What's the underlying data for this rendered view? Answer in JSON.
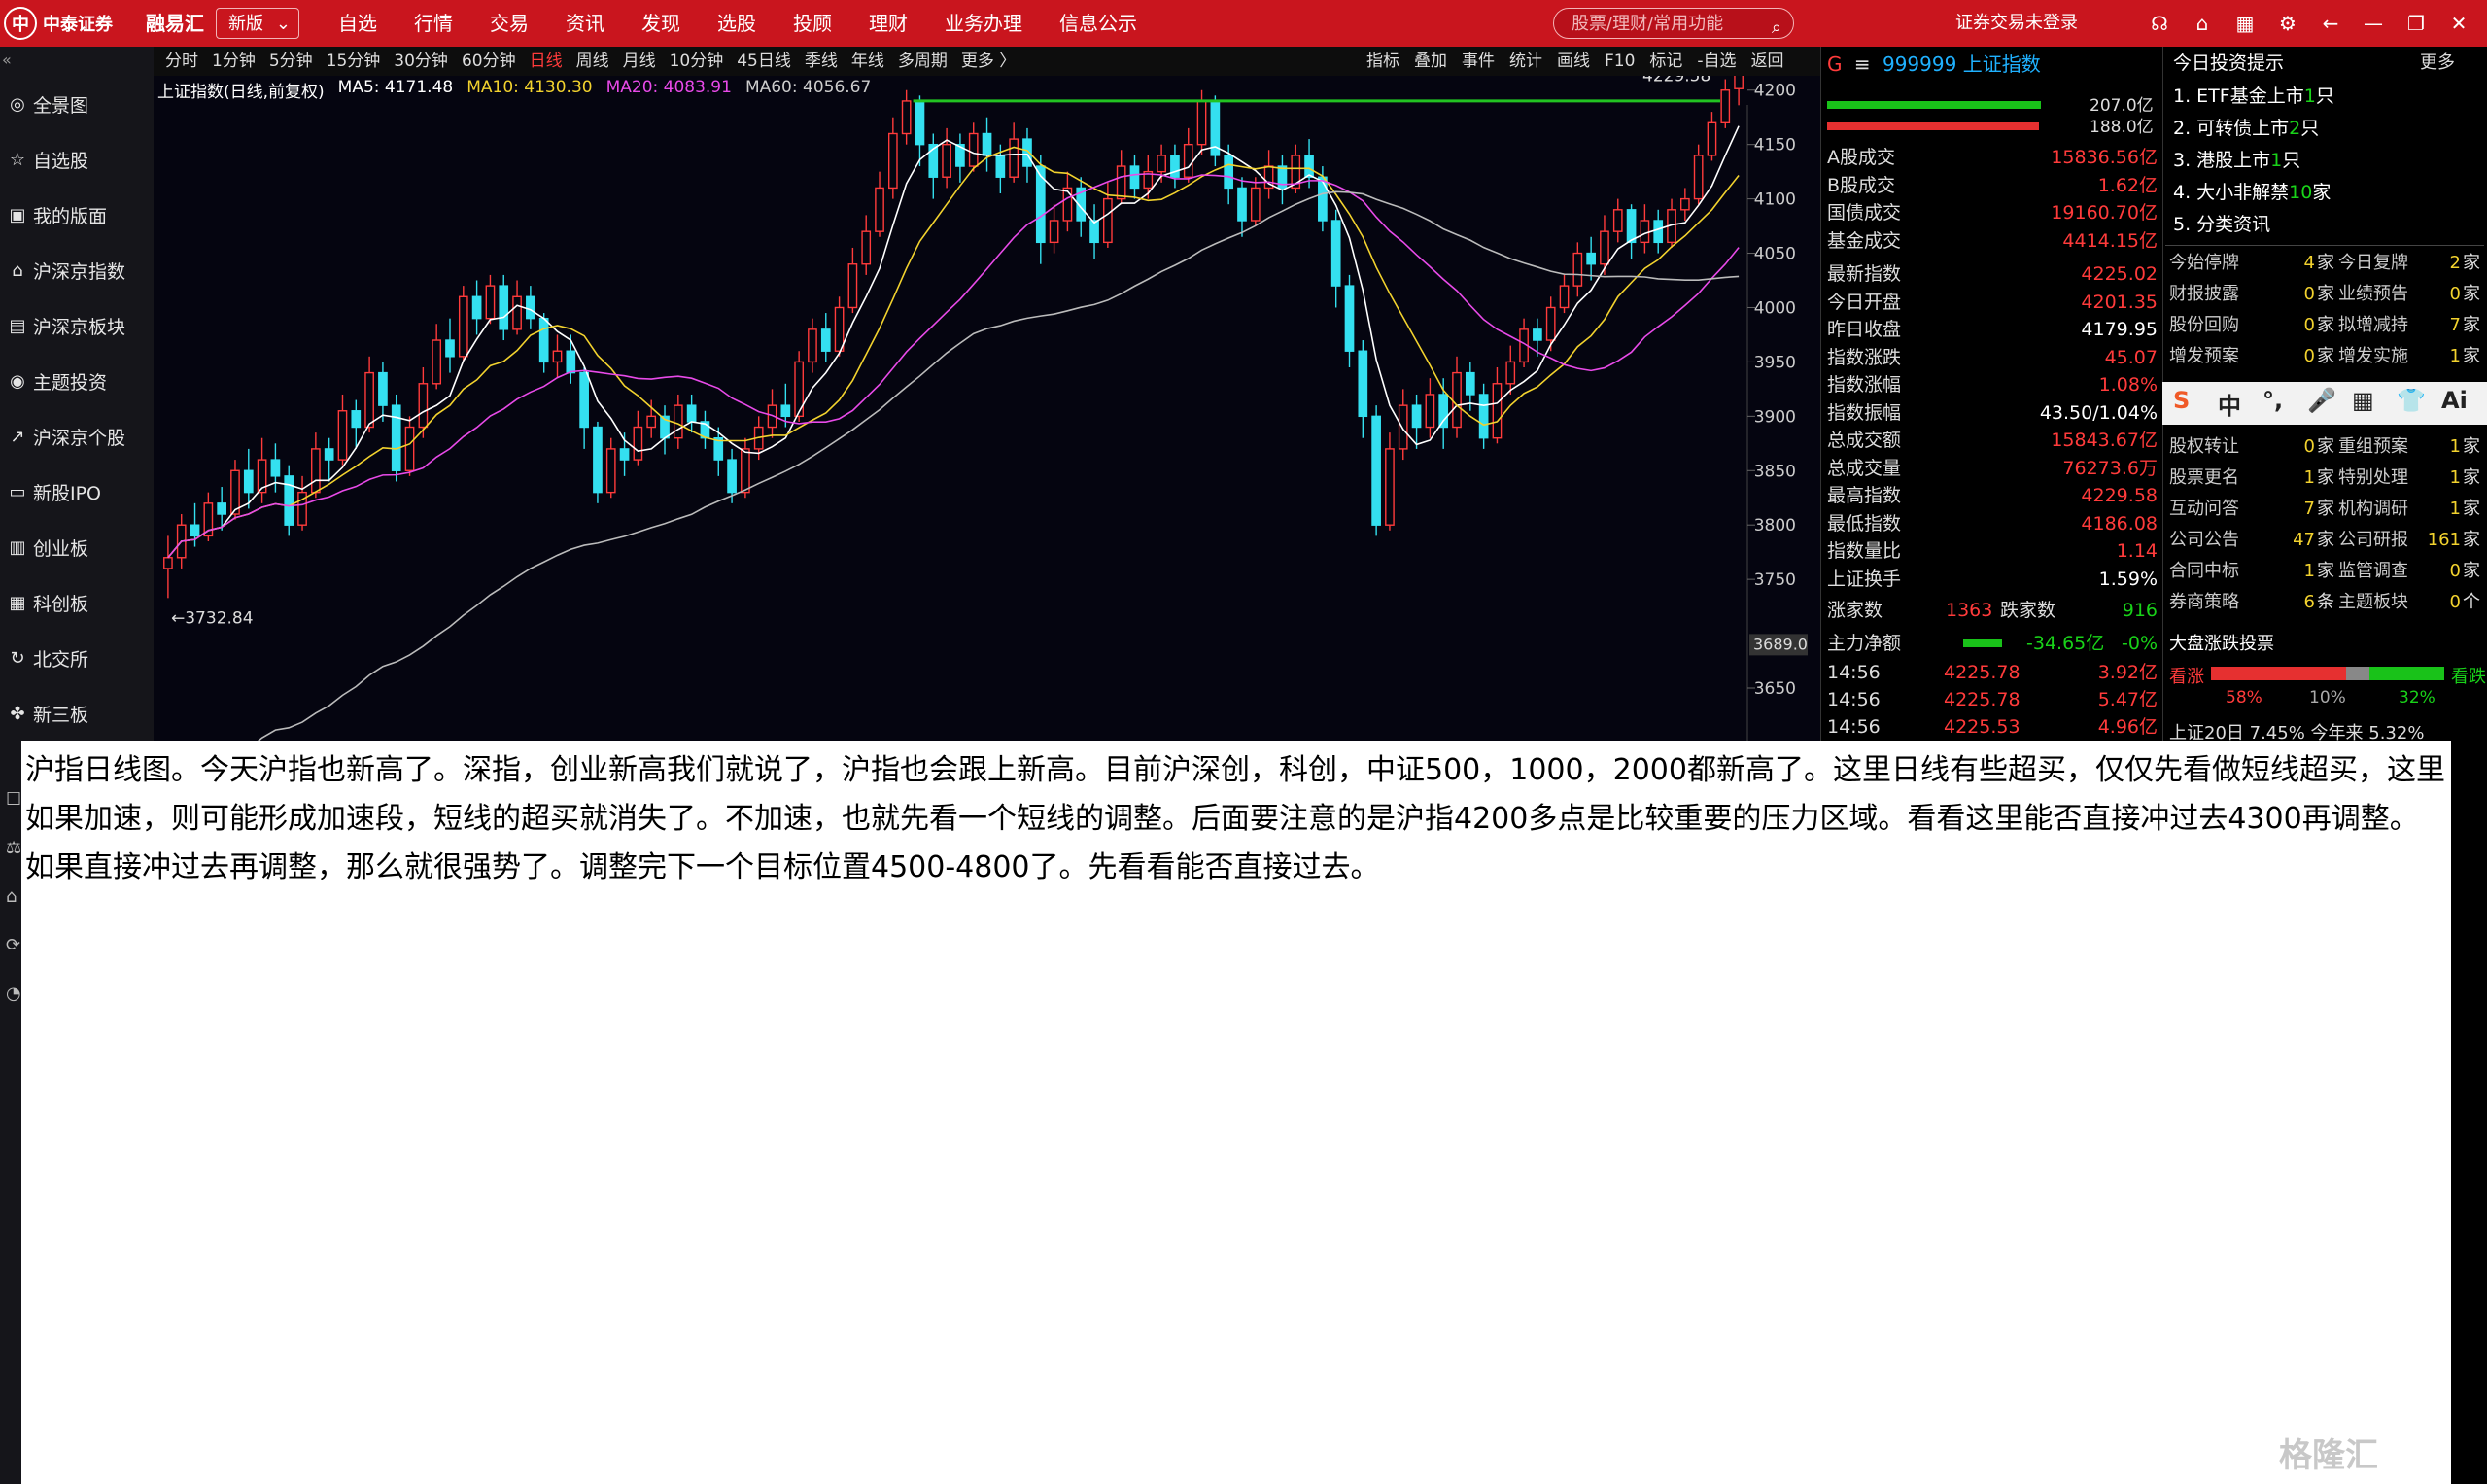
{
  "topbar": {
    "logo_text": "中泰证券",
    "brand2": "融易汇",
    "version_select": "新版",
    "nav": [
      "自选",
      "行情",
      "交易",
      "资讯",
      "发现",
      "选股",
      "投顾",
      "理财",
      "业务办理",
      "信息公示"
    ],
    "search_placeholder": "股票/理财/常用功能",
    "login_status": "证券交易未登录",
    "colors": {
      "bar": "#c9151e"
    }
  },
  "sidebar": {
    "items": [
      {
        "icon": "globe-icon",
        "label": "全景图"
      },
      {
        "icon": "star-icon",
        "label": "自选股"
      },
      {
        "icon": "layout-icon",
        "label": "我的版面"
      },
      {
        "icon": "index-icon",
        "label": "沪深京指数"
      },
      {
        "icon": "sector-icon",
        "label": "沪深京板块"
      },
      {
        "icon": "theme-icon",
        "label": "主题投资"
      },
      {
        "icon": "stock-icon",
        "label": "沪深京个股"
      },
      {
        "icon": "ipo-icon",
        "label": "新股IPO"
      },
      {
        "icon": "gem-icon",
        "label": "创业板"
      },
      {
        "icon": "star-market-icon",
        "label": "科创板"
      },
      {
        "icon": "bse-icon",
        "label": "北交所"
      },
      {
        "icon": "neeq-icon",
        "label": "新三板"
      }
    ]
  },
  "chart_toolbar": {
    "periods": [
      "分时",
      "1分钟",
      "5分钟",
      "15分钟",
      "30分钟",
      "60分钟",
      "日线",
      "周线",
      "月线",
      "10分钟",
      "45日线",
      "季线",
      "年线",
      "多周期",
      "更多 〉"
    ],
    "active_period": "日线",
    "tools": [
      "指标",
      "叠加",
      "事件",
      "统计",
      "画线",
      "F10",
      "标记",
      "-自选",
      "返回"
    ]
  },
  "ma_legend": {
    "title": "上证指数(日线,前复权)",
    "ma5": "MA5: 4171.48",
    "ma10": "MA10: 4130.30",
    "ma20": "MA20: 4083.91",
    "ma60": "MA60: 4056.67"
  },
  "chart_data": {
    "type": "candlestick",
    "y_ticks": [
      "4200",
      "4150",
      "4100",
      "4050",
      "4000",
      "3950",
      "3900",
      "3850",
      "3800",
      "3750",
      "3650"
    ],
    "ylim": [
      3650,
      4240
    ],
    "current_price_tag": "3689.0",
    "annotations": {
      "high_label": "4229.58",
      "low_label": "3732.84",
      "resistance_level": 4190
    },
    "candles": [
      [
        3760,
        3770,
        3732.84,
        3790
      ],
      [
        3770,
        3800,
        3760,
        3810
      ],
      [
        3800,
        3790,
        3780,
        3820
      ],
      [
        3790,
        3820,
        3785,
        3830
      ],
      [
        3820,
        3810,
        3795,
        3835
      ],
      [
        3810,
        3850,
        3805,
        3860
      ],
      [
        3850,
        3830,
        3815,
        3870
      ],
      [
        3830,
        3860,
        3820,
        3880
      ],
      [
        3860,
        3845,
        3830,
        3875
      ],
      [
        3845,
        3800,
        3790,
        3855
      ],
      [
        3800,
        3830,
        3795,
        3845
      ],
      [
        3830,
        3870,
        3825,
        3885
      ],
      [
        3870,
        3860,
        3840,
        3880
      ],
      [
        3860,
        3905,
        3855,
        3920
      ],
      [
        3905,
        3890,
        3870,
        3915
      ],
      [
        3890,
        3940,
        3885,
        3955
      ],
      [
        3940,
        3910,
        3895,
        3950
      ],
      [
        3910,
        3850,
        3840,
        3920
      ],
      [
        3850,
        3890,
        3845,
        3900
      ],
      [
        3890,
        3930,
        3880,
        3945
      ],
      [
        3930,
        3970,
        3925,
        3985
      ],
      [
        3970,
        3955,
        3940,
        3990
      ],
      [
        3955,
        4010,
        3950,
        4020
      ],
      [
        4010,
        3990,
        3975,
        4025
      ],
      [
        3990,
        4020,
        3985,
        4030
      ],
      [
        4020,
        3980,
        3970,
        4030
      ],
      [
        3980,
        4010,
        3975,
        4025
      ],
      [
        4010,
        3990,
        3980,
        4020
      ],
      [
        3990,
        3950,
        3940,
        3995
      ],
      [
        3950,
        3960,
        3935,
        3975
      ],
      [
        3960,
        3940,
        3930,
        3975
      ],
      [
        3940,
        3890,
        3870,
        3945
      ],
      [
        3890,
        3830,
        3820,
        3895
      ],
      [
        3830,
        3870,
        3825,
        3880
      ],
      [
        3870,
        3860,
        3845,
        3885
      ],
      [
        3860,
        3890,
        3855,
        3905
      ],
      [
        3890,
        3900,
        3880,
        3915
      ],
      [
        3900,
        3880,
        3865,
        3910
      ],
      [
        3880,
        3910,
        3870,
        3920
      ],
      [
        3910,
        3895,
        3885,
        3920
      ],
      [
        3895,
        3880,
        3870,
        3905
      ],
      [
        3880,
        3860,
        3845,
        3890
      ],
      [
        3860,
        3830,
        3820,
        3870
      ],
      [
        3830,
        3870,
        3825,
        3880
      ],
      [
        3870,
        3890,
        3860,
        3900
      ],
      [
        3890,
        3910,
        3880,
        3925
      ],
      [
        3910,
        3900,
        3890,
        3930
      ],
      [
        3900,
        3950,
        3895,
        3960
      ],
      [
        3950,
        3980,
        3940,
        3990
      ],
      [
        3980,
        3960,
        3950,
        3995
      ],
      [
        3960,
        4000,
        3955,
        4010
      ],
      [
        4000,
        4040,
        3995,
        4055
      ],
      [
        4040,
        4070,
        4030,
        4085
      ],
      [
        4070,
        4110,
        4065,
        4125
      ],
      [
        4110,
        4160,
        4100,
        4175
      ],
      [
        4160,
        4190,
        4150,
        4200
      ],
      [
        4190,
        4150,
        4130,
        4195
      ],
      [
        4150,
        4120,
        4100,
        4160
      ],
      [
        4120,
        4150,
        4110,
        4165
      ],
      [
        4150,
        4130,
        4115,
        4160
      ],
      [
        4130,
        4160,
        4125,
        4170
      ],
      [
        4160,
        4140,
        4125,
        4175
      ],
      [
        4140,
        4120,
        4105,
        4150
      ],
      [
        4120,
        4155,
        4115,
        4170
      ],
      [
        4155,
        4130,
        4115,
        4165
      ],
      [
        4130,
        4060,
        4040,
        4140
      ],
      [
        4060,
        4080,
        4050,
        4095
      ],
      [
        4080,
        4110,
        4070,
        4125
      ],
      [
        4110,
        4080,
        4065,
        4120
      ],
      [
        4080,
        4060,
        4045,
        4095
      ],
      [
        4060,
        4100,
        4055,
        4115
      ],
      [
        4100,
        4130,
        4095,
        4145
      ],
      [
        4130,
        4110,
        4100,
        4140
      ],
      [
        4110,
        4125,
        4100,
        4140
      ],
      [
        4125,
        4140,
        4115,
        4150
      ],
      [
        4140,
        4120,
        4110,
        4150
      ],
      [
        4120,
        4150,
        4115,
        4165
      ],
      [
        4150,
        4190,
        4140,
        4200
      ],
      [
        4190,
        4140,
        4130,
        4195
      ],
      [
        4140,
        4110,
        4095,
        4150
      ],
      [
        4110,
        4080,
        4065,
        4120
      ],
      [
        4080,
        4110,
        4075,
        4120
      ],
      [
        4110,
        4130,
        4100,
        4145
      ],
      [
        4130,
        4110,
        4095,
        4140
      ],
      [
        4110,
        4140,
        4105,
        4150
      ],
      [
        4140,
        4120,
        4110,
        4155
      ],
      [
        4120,
        4080,
        4070,
        4130
      ],
      [
        4080,
        4020,
        4000,
        4090
      ],
      [
        4020,
        3960,
        3945,
        4030
      ],
      [
        3960,
        3900,
        3880,
        3970
      ],
      [
        3900,
        3800,
        3790,
        3910
      ],
      [
        3800,
        3870,
        3795,
        3885
      ],
      [
        3870,
        3910,
        3860,
        3925
      ],
      [
        3910,
        3890,
        3870,
        3920
      ],
      [
        3890,
        3920,
        3880,
        3935
      ],
      [
        3920,
        3890,
        3870,
        3935
      ],
      [
        3890,
        3940,
        3880,
        3955
      ],
      [
        3940,
        3920,
        3905,
        3950
      ],
      [
        3920,
        3880,
        3870,
        3930
      ],
      [
        3880,
        3930,
        3875,
        3945
      ],
      [
        3930,
        3950,
        3920,
        3965
      ],
      [
        3950,
        3980,
        3945,
        3990
      ],
      [
        3980,
        3970,
        3955,
        3990
      ],
      [
        3970,
        4000,
        3960,
        4010
      ],
      [
        4000,
        4020,
        3995,
        4030
      ],
      [
        4020,
        4050,
        4010,
        4060
      ],
      [
        4050,
        4040,
        4025,
        4065
      ],
      [
        4040,
        4070,
        4030,
        4085
      ],
      [
        4070,
        4090,
        4060,
        4100
      ],
      [
        4090,
        4060,
        4045,
        4095
      ],
      [
        4060,
        4080,
        4050,
        4095
      ],
      [
        4080,
        4060,
        4050,
        4090
      ],
      [
        4060,
        4090,
        4055,
        4100
      ],
      [
        4090,
        4100,
        4080,
        4110
      ],
      [
        4100,
        4140,
        4095,
        4150
      ],
      [
        4140,
        4170,
        4135,
        4180
      ],
      [
        4170,
        4200,
        4165,
        4210
      ],
      [
        4201.35,
        4225.02,
        4186.08,
        4229.58
      ]
    ]
  },
  "quote": {
    "code": "999999",
    "name": "上证指数",
    "volbars": [
      "207.0亿",
      "188.0亿"
    ],
    "rows": [
      {
        "k": "A股成交",
        "v": "15836.56亿",
        "c": "red"
      },
      {
        "k": "B股成交",
        "v": "1.62亿",
        "c": "red"
      },
      {
        "k": "国债成交",
        "v": "19160.70亿",
        "c": "red"
      },
      {
        "k": "基金成交",
        "v": "4414.15亿",
        "c": "red"
      },
      {
        "k": "最新指数",
        "v": "4225.02",
        "c": "red"
      },
      {
        "k": "今日开盘",
        "v": "4201.35",
        "c": "red"
      },
      {
        "k": "昨日收盘",
        "v": "4179.95",
        "c": "white"
      },
      {
        "k": "指数涨跌",
        "v": "45.07",
        "c": "red"
      },
      {
        "k": "指数涨幅",
        "v": "1.08%",
        "c": "red"
      },
      {
        "k": "指数振幅",
        "v": "43.50/1.04%",
        "c": "white"
      },
      {
        "k": "总成交额",
        "v": "15843.67亿",
        "c": "red"
      },
      {
        "k": "总成交量",
        "v": "76273.6万",
        "c": "red"
      },
      {
        "k": "最高指数",
        "v": "4229.58",
        "c": "red"
      },
      {
        "k": "最低指数",
        "v": "4186.08",
        "c": "red"
      },
      {
        "k": "指数量比",
        "v": "1.14",
        "c": "red"
      },
      {
        "k": "上证换手",
        "v": "1.59%",
        "c": "white"
      }
    ],
    "up_label": "涨家数",
    "up_count": "1363",
    "down_label": "跌家数",
    "down_count": "916",
    "netflow_label": "主力净额",
    "netflow_value": "-34.65亿",
    "netflow_pct": "-0%",
    "ticks": [
      {
        "t": "14:56",
        "p": "4225.78",
        "a": "3.92亿"
      },
      {
        "t": "14:56",
        "p": "4225.78",
        "a": "5.47亿"
      },
      {
        "t": "14:56",
        "p": "4225.53",
        "a": "4.96亿"
      }
    ]
  },
  "tips": {
    "title": "今日投资提示",
    "more": "更多",
    "list": [
      {
        "pre": "1. ETF基金上市",
        "num": "1",
        "suf": "只"
      },
      {
        "pre": "2. 可转债上市",
        "num": "2",
        "suf": "只"
      },
      {
        "pre": "3. 港股上市",
        "num": "1",
        "suf": "只"
      },
      {
        "pre": "4. 大小非解禁",
        "num": "10",
        "suf": "家"
      },
      {
        "pre": "5. 分类资讯",
        "num": "",
        "suf": ""
      }
    ],
    "events": [
      [
        "今始停牌",
        "4",
        "家",
        "今日复牌",
        "2",
        "家"
      ],
      [
        "财报披露",
        "0",
        "家",
        "业绩预告",
        "0",
        "家"
      ],
      [
        "股份回购",
        "0",
        "家",
        "拟增减持",
        "7",
        "家"
      ],
      [
        "增发预案",
        "0",
        "家",
        "增发实施",
        "1",
        "家"
      ],
      [
        "股权转让",
        "0",
        "家",
        "重组预案",
        "1",
        "家"
      ],
      [
        "股票更名",
        "1",
        "家",
        "特别处理",
        "1",
        "家"
      ],
      [
        "互动问答",
        "7",
        "家",
        "机构调研",
        "1",
        "家"
      ],
      [
        "公司公告",
        "47",
        "家",
        "公司研报",
        "161",
        "家"
      ],
      [
        "合同中标",
        "1",
        "家",
        "监管调查",
        "0",
        "家"
      ],
      [
        "券商策略",
        "6",
        "条",
        "主题板块",
        "0",
        "个"
      ]
    ],
    "ime": [
      "S",
      "中",
      "°,",
      "🎤",
      "▦",
      "👕",
      "Ai"
    ],
    "vote_title": "大盘涨跌投票",
    "vote_up": "看涨",
    "vote_down": "看跌",
    "vote_up_pct": "58%",
    "vote_flat_pct": "10%",
    "vote_down_pct": "32%",
    "bottom_cut": "上证20日 7.45% 今年来 5.32%"
  },
  "commentary": "沪指日线图。今天沪指也新高了。深指，创业新高我们就说了，沪指也会跟上新高。目前沪深创，科创，中证500，1000，2000都新高了。这里日线有些超买，仅仅先看做短线超买，这里如果加速，则可能形成加速段，短线的超买就消失了。不加速，也就先看一个短线的调整。后面要注意的是沪指4200多点是比较重要的压力区域。看看这里能否直接冲过去4300再调整。如果直接冲过去再调整，那么就很强势了。调整完下一个目标位置4500-4800了。先看看能否直接过去。",
  "watermark": "格隆汇"
}
